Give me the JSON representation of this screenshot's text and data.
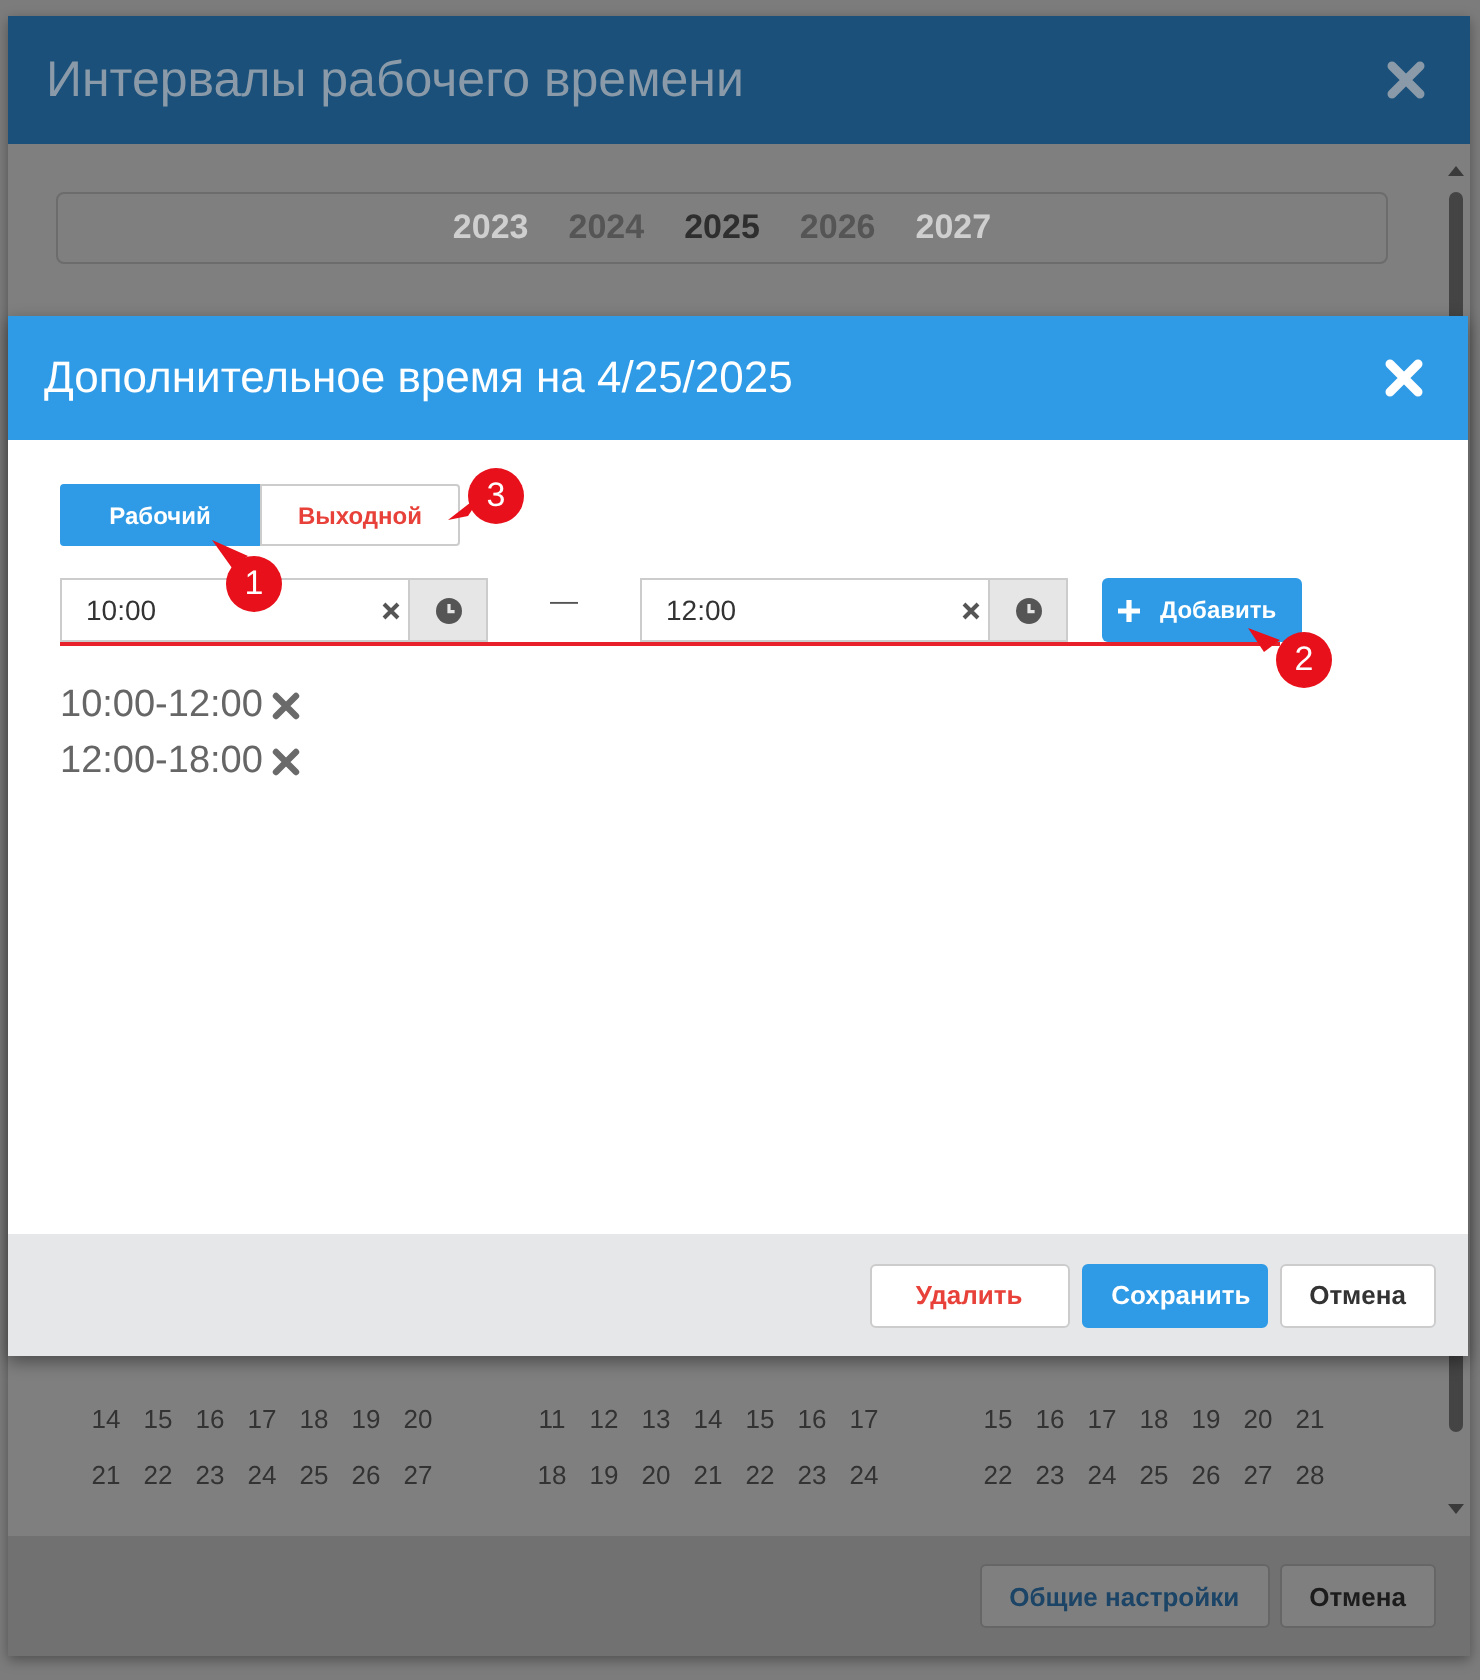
{
  "background_dialog": {
    "title": "Интервалы рабочего времени",
    "years": [
      {
        "label": "2023",
        "selected": false
      },
      {
        "label": "2024",
        "selected": false
      },
      {
        "label": "2025",
        "selected": true
      },
      {
        "label": "2026",
        "selected": false
      },
      {
        "label": "2027",
        "selected": false
      }
    ],
    "calendar": [
      {
        "weeks": [
          [
            "14",
            "15",
            "16",
            "17",
            "18",
            "19",
            "20"
          ],
          [
            "21",
            "22",
            "23",
            "24",
            "25",
            "26",
            "27"
          ]
        ]
      },
      {
        "weeks": [
          [
            "11",
            "12",
            "13",
            "14",
            "15",
            "16",
            "17"
          ],
          [
            "18",
            "19",
            "20",
            "21",
            "22",
            "23",
            "24"
          ]
        ]
      },
      {
        "weeks": [
          [
            "15",
            "16",
            "17",
            "18",
            "19",
            "20",
            "21"
          ],
          [
            "22",
            "23",
            "24",
            "25",
            "26",
            "27",
            "28"
          ]
        ]
      }
    ],
    "footer_buttons": [
      {
        "label": "Общие настройки",
        "kind": "link"
      },
      {
        "label": "Отмена",
        "kind": "default"
      }
    ]
  },
  "modal": {
    "title": "Дополнительное время на 4/25/2025",
    "day_types": [
      {
        "label": "Рабочий",
        "selected": true
      },
      {
        "label": "Выходной",
        "selected": false
      }
    ],
    "from_time": {
      "value": "10:00"
    },
    "separator": "—",
    "to_time": {
      "value": "12:00"
    },
    "add_button": {
      "label": "Добавить"
    },
    "intervals": [
      "10:00-12:00",
      "12:00-18:00"
    ],
    "footer_buttons": [
      {
        "label": "Удалить",
        "kind": "danger"
      },
      {
        "label": "Сохранить",
        "kind": "primary"
      },
      {
        "label": "Отмена",
        "kind": "default"
      }
    ],
    "annotations": [
      {
        "number": "1"
      },
      {
        "number": "2"
      },
      {
        "number": "3"
      }
    ]
  }
}
